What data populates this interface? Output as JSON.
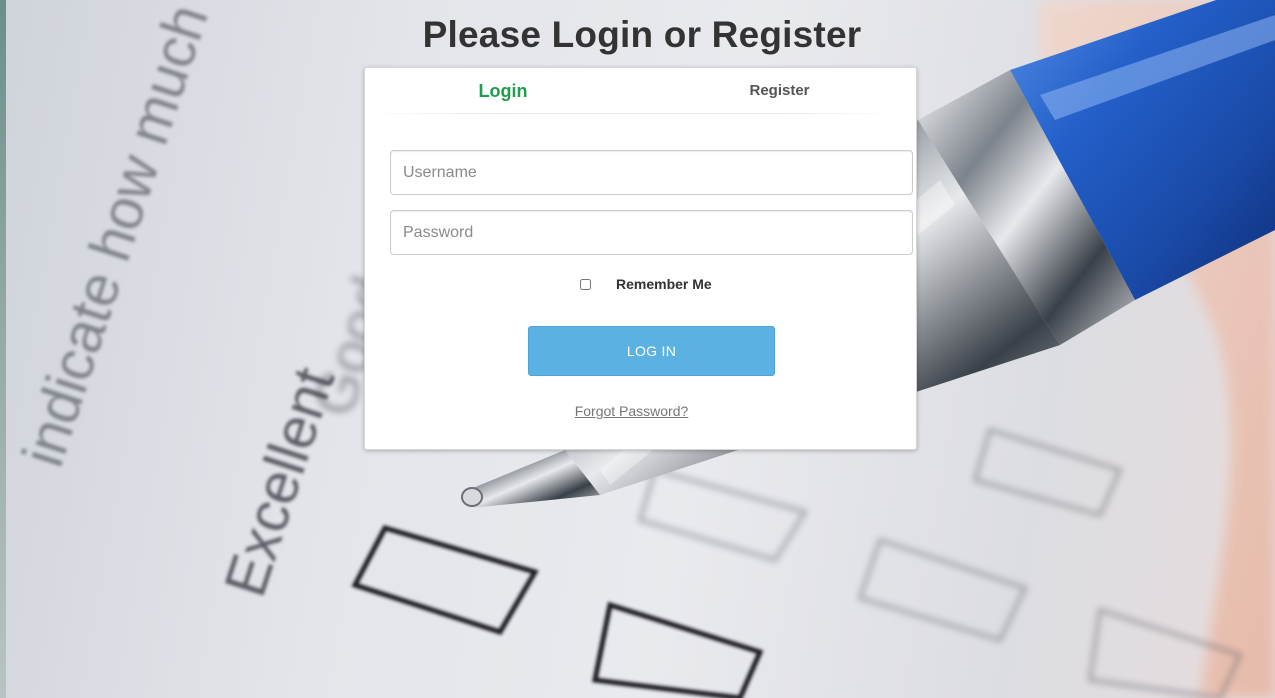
{
  "page": {
    "title": "Please Login or Register"
  },
  "tabs": [
    {
      "label": "Login",
      "active": true
    },
    {
      "label": "Register",
      "active": false
    }
  ],
  "form": {
    "username_placeholder": "Username",
    "username_value": "",
    "password_placeholder": "Password",
    "password_value": "",
    "remember_label": "Remember Me",
    "remember_checked": false,
    "submit_label": "LOG IN",
    "forgot_label": "Forgot Password?"
  },
  "colors": {
    "active_tab": "#1e9e4a",
    "submit_button": "#5bb2e2",
    "title": "#333333"
  },
  "background": {
    "printed_words": [
      "indicate how much",
      "Excellent",
      "Good"
    ]
  }
}
